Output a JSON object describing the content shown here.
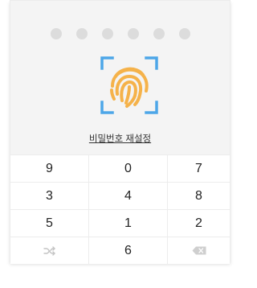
{
  "lock_screen": {
    "pin_length": 6,
    "reset_link_label": "비밀번호 재설정",
    "accent_colors": {
      "frame": "#4da6e8",
      "fingerprint": "#f5b24a"
    }
  },
  "keypad": {
    "rows": [
      [
        "9",
        "0",
        "7"
      ],
      [
        "3",
        "4",
        "8"
      ],
      [
        "5",
        "1",
        "2"
      ]
    ],
    "bottom_row": {
      "left_icon": "shuffle-icon",
      "middle": "6",
      "right_icon": "backspace-icon"
    }
  }
}
